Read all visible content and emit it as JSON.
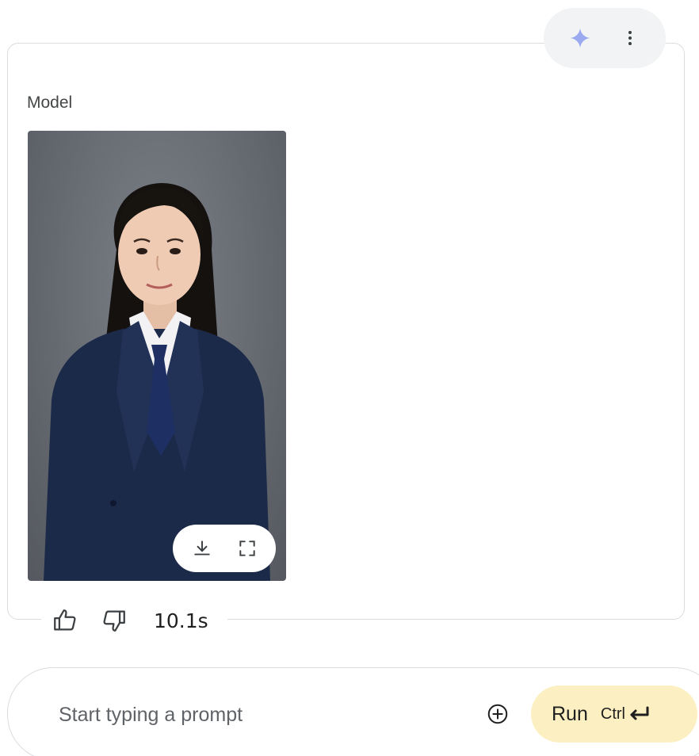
{
  "response": {
    "role_label": "Model",
    "elapsed": "10.1s",
    "image_alt": "Portrait of a woman in a navy suit and tie against a gray background"
  },
  "card_actions": {
    "sparkle_icon": "sparkle-icon",
    "more_icon": "more-vert-icon"
  },
  "image_toolbar": {
    "download_icon": "download-icon",
    "fullscreen_icon": "fullscreen-icon"
  },
  "feedback": {
    "like_icon": "thumbs-up-icon",
    "dislike_icon": "thumbs-down-icon"
  },
  "prompt": {
    "placeholder": "Start typing a prompt",
    "value": "",
    "run_label": "Run",
    "shortcut_label": "Ctrl"
  },
  "colors": {
    "accent_sparkle": "#8ab4f8",
    "run_button_bg": "#fcefc2",
    "border": "#dadce0",
    "suit": "#1c2a4a"
  }
}
